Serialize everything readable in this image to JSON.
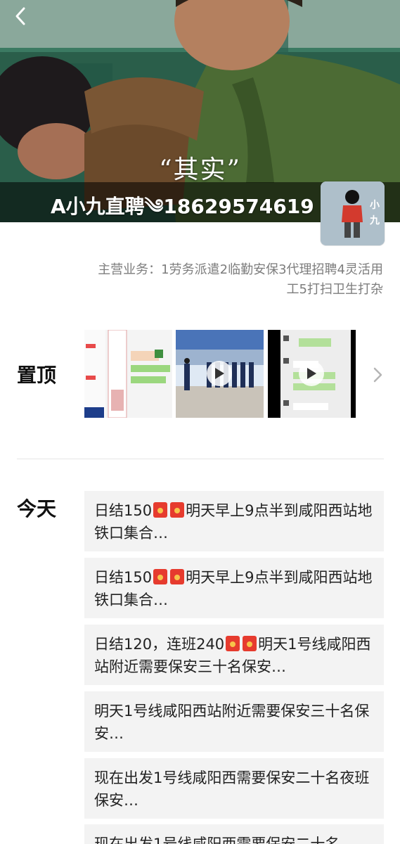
{
  "header": {
    "back_icon": "chevron-left-icon",
    "cover_subtitle": "“其实”",
    "profile_name": "A小九直聘༄18629574619",
    "avatar_text": "小九"
  },
  "bio": {
    "text": "主营业务：1劳务派遣2临勤安保3代理招聘4灵活用工5打扫卫生打杂"
  },
  "pinned": {
    "label": "置顶",
    "items": [
      {
        "type": "image",
        "desc": "chat-screenshot"
      },
      {
        "type": "video",
        "desc": "security-team"
      },
      {
        "type": "video",
        "desc": "chat-screenshot"
      }
    ],
    "more_icon": "chevron-right-icon"
  },
  "today": {
    "label": "今天",
    "posts": [
      {
        "before": "日结150",
        "packets": 2,
        "after": "明天早上9点半到咸阳西站地铁口集合…"
      },
      {
        "before": "日结150",
        "packets": 2,
        "after": "明天早上9点半到咸阳西站地铁口集合…"
      },
      {
        "before": "日结120，连班240",
        "packets": 2,
        "after": "明天1号线咸阳西站附近需要保安三十名保安…"
      },
      {
        "before": "明天1号线咸阳西站附近需要保安三十名保安…",
        "packets": 0,
        "after": ""
      },
      {
        "before": "现在出发1号线咸阳西需要保安二十名夜班保安…",
        "packets": 0,
        "after": ""
      },
      {
        "before": "现在出发1号线咸阳西需要保安二十名",
        "packets": 0,
        "after": ""
      }
    ]
  },
  "colors": {
    "red_packet": "#e63b2e",
    "post_bg": "#f3f3f3",
    "bio_text": "#7d7d7d"
  }
}
